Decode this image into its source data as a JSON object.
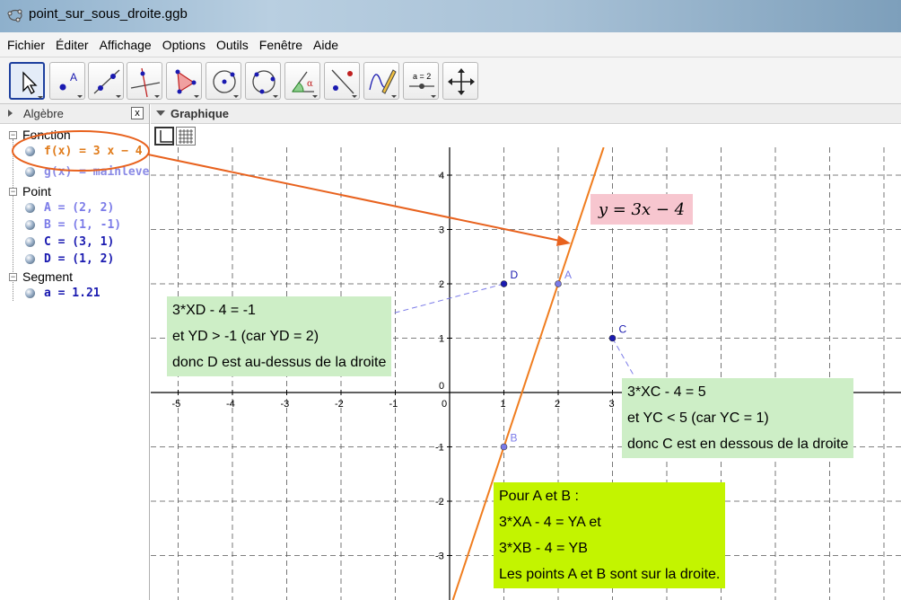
{
  "window": {
    "title": "point_sur_sous_droite.ggb"
  },
  "menu": [
    "Fichier",
    "Éditer",
    "Affichage",
    "Options",
    "Outils",
    "Fenêtre",
    "Aide"
  ],
  "toolbar": {
    "tools": [
      "move-tool",
      "point-tool",
      "line-tool",
      "perpendicular-tool",
      "polygon-tool",
      "circle-tool",
      "conic-tool",
      "angle-tool",
      "reflect-tool",
      "freehand-tool",
      "slider-tool",
      "move-view-tool"
    ],
    "slider_label": "a = 2"
  },
  "algebra": {
    "title": "Algèbre",
    "close_label": "x",
    "categories": [
      {
        "name": "Fonction",
        "items": [
          {
            "text": "f(x) = 3 x − 4",
            "color": "#e07b1a"
          },
          {
            "text": "g(x) = mainlevee",
            "color": "#8a8ae6"
          }
        ]
      },
      {
        "name": "Point",
        "items": [
          {
            "text": "A = (2, 2)",
            "color": "#7b7be8"
          },
          {
            "text": "B = (1, -1)",
            "color": "#7b7be8"
          },
          {
            "text": "C = (3, 1)",
            "color": "#1a1ab0"
          },
          {
            "text": "D = (1, 2)",
            "color": "#1a1ab0"
          }
        ]
      },
      {
        "name": "Segment",
        "items": [
          {
            "text": "a = 1.21",
            "color": "#1a1ab0"
          }
        ]
      }
    ]
  },
  "graphics": {
    "title": "Graphique",
    "x_ticks": [
      "-5",
      "-4",
      "-3",
      "-2",
      "-1",
      "0",
      "1",
      "2",
      "3"
    ],
    "y_ticks_pos": [
      "4",
      "3",
      "2",
      "1"
    ],
    "y_ticks_neg": [
      "-1",
      "-2",
      "-3"
    ],
    "y_zero": "0",
    "line_equation": "y = 3x − 4",
    "points": [
      {
        "name": "A",
        "x": 2,
        "y": 2,
        "color": "#7b7be8"
      },
      {
        "name": "B",
        "x": 1,
        "y": -1,
        "color": "#7b7be8"
      },
      {
        "name": "C",
        "x": 3,
        "y": 1,
        "color": "#1a1ab0"
      },
      {
        "name": "D",
        "x": 1,
        "y": 2,
        "color": "#1a1ab0"
      }
    ],
    "note_D": [
      "3*XD - 4 = -1",
      "et YD > -1 (car YD = 2)",
      "donc D est au-dessus de la droite"
    ],
    "note_C": [
      "3*XC - 4 = 5",
      "et YC < 5 (car YC = 1)",
      "donc C est en dessous de la droite"
    ],
    "note_AB": [
      "Pour A et B :",
      "3*XA - 4 = YA et",
      "3*XB - 4 = YB",
      "Les points A et B sont sur la droite."
    ]
  },
  "colors": {
    "line": "#f07d1e",
    "annotation": "#e8621e",
    "point_dark": "#1a1ab0",
    "point_light": "#7b7be8"
  }
}
